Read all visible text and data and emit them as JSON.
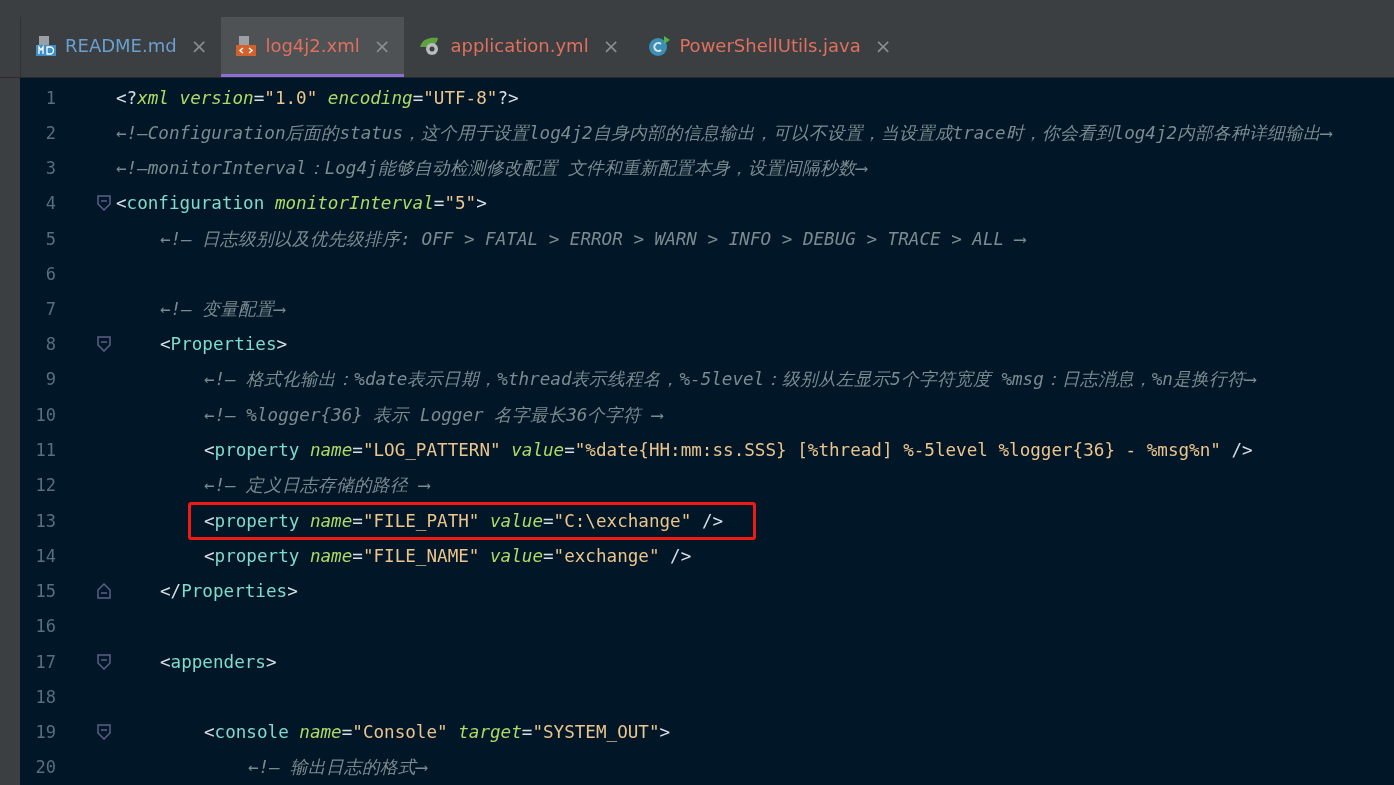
{
  "tabs": [
    {
      "label": "README.md",
      "kind": "md",
      "selected": false,
      "color": "#6a9fd0"
    },
    {
      "label": "log4j2.xml",
      "kind": "xml",
      "selected": true,
      "color": "#e0705e"
    },
    {
      "label": "application.yml",
      "kind": "yml",
      "selected": false,
      "color": "#e0705e"
    },
    {
      "label": "PowerShellUtils.java",
      "kind": "java",
      "selected": false,
      "color": "#e0705e"
    }
  ],
  "close_label": "×",
  "lines": [
    {
      "number": "1",
      "tokens": [
        {
          "kind": "punct",
          "text": "<?"
        },
        {
          "kind": "attr",
          "text": "xml"
        },
        {
          "kind": "attr",
          "text": " version"
        },
        {
          "kind": "punct",
          "text": "="
        },
        {
          "kind": "value",
          "text": "\"1.0\""
        },
        {
          "kind": "attr",
          "text": " encoding"
        },
        {
          "kind": "punct",
          "text": "="
        },
        {
          "kind": "value",
          "text": "\"UTF-8\""
        },
        {
          "kind": "punct",
          "text": "?>"
        }
      ]
    },
    {
      "number": "2",
      "tokens": [
        {
          "kind": "comment",
          "text": "←!—Configuration后面的status，这个用于设置log4j2自身内部的信息输出，可以不设置，当设置成trace时，你会看到log4j2内部各种详细输出⟶"
        }
      ]
    },
    {
      "number": "3",
      "tokens": [
        {
          "kind": "comment",
          "text": "←!—monitorInterval：Log4j能够自动检测修改配置 文件和重新配置本身，设置间隔秒数⟶"
        }
      ]
    },
    {
      "number": "4",
      "fold_start": true,
      "tokens": [
        {
          "kind": "punct",
          "text": "<"
        },
        {
          "kind": "tag",
          "text": "configuration"
        },
        {
          "kind": "attr",
          "text": " monitorInterval"
        },
        {
          "kind": "punct",
          "text": "="
        },
        {
          "kind": "value",
          "text": "\"5\""
        },
        {
          "kind": "punct",
          "text": ">"
        }
      ],
      "children": [
        {
          "number": "5",
          "tokens": [
            {
              "kind": "comment",
              "text": "←!— 日志级别以及优先级排序: OFF > FATAL > ERROR > WARN > INFO > DEBUG > TRACE > ALL ⟶"
            }
          ]
        },
        {
          "number": "6"
        },
        {
          "number": "7",
          "tokens": [
            {
              "kind": "comment",
              "text": "←!— 变量配置⟶"
            }
          ]
        },
        {
          "number": "8",
          "fold_start": true,
          "tokens": [
            {
              "kind": "punct",
              "text": "<"
            },
            {
              "kind": "tag",
              "text": "Properties"
            },
            {
              "kind": "punct",
              "text": ">"
            }
          ],
          "children": [
            {
              "number": "9",
              "tokens": [
                {
                  "kind": "comment",
                  "text": "←!— 格式化输出：%date表示日期，%thread表示线程名，%-5level：级别从左显示5个字符宽度 %msg：日志消息，%n是换行符⟶"
                }
              ]
            },
            {
              "number": "10",
              "tokens": [
                {
                  "kind": "comment",
                  "text": "←!— %logger{36} 表示 Logger 名字最长36个字符 ⟶"
                }
              ]
            },
            {
              "number": "11",
              "tokens": [
                {
                  "kind": "punct",
                  "text": "<"
                },
                {
                  "kind": "tag",
                  "text": "property"
                },
                {
                  "kind": "attr",
                  "text": " name"
                },
                {
                  "kind": "punct",
                  "text": "="
                },
                {
                  "kind": "value",
                  "text": "\"LOG_PATTERN\""
                },
                {
                  "kind": "attr",
                  "text": " value"
                },
                {
                  "kind": "punct",
                  "text": "="
                },
                {
                  "kind": "value",
                  "text": "\"%date{HH:mm:ss.SSS} [%thread] %-5level %logger{36} - %msg%n\""
                },
                {
                  "kind": "punct",
                  "text": " />"
                }
              ]
            },
            {
              "number": "12",
              "tokens": [
                {
                  "kind": "comment",
                  "text": "←!— 定义日志存储的路径 ⟶"
                }
              ]
            },
            {
              "number": "13",
              "highlighted": true,
              "tokens": [
                {
                  "kind": "punct",
                  "text": "<"
                },
                {
                  "kind": "tag",
                  "text": "property"
                },
                {
                  "kind": "attr",
                  "text": " name"
                },
                {
                  "kind": "punct",
                  "text": "="
                },
                {
                  "kind": "value",
                  "text": "\"FILE_PATH\""
                },
                {
                  "kind": "attr",
                  "text": " value"
                },
                {
                  "kind": "punct",
                  "text": "="
                },
                {
                  "kind": "value",
                  "text": "\"C:\\exchange\""
                },
                {
                  "kind": "punct",
                  "text": " />"
                }
              ]
            },
            {
              "number": "14",
              "tokens": [
                {
                  "kind": "punct",
                  "text": "<"
                },
                {
                  "kind": "tag",
                  "text": "property"
                },
                {
                  "kind": "attr",
                  "text": " name"
                },
                {
                  "kind": "punct",
                  "text": "="
                },
                {
                  "kind": "value",
                  "text": "\"FILE_NAME\""
                },
                {
                  "kind": "attr",
                  "text": " value"
                },
                {
                  "kind": "punct",
                  "text": "="
                },
                {
                  "kind": "value",
                  "text": "\"exchange\""
                },
                {
                  "kind": "punct",
                  "text": " />"
                }
              ]
            }
          ]
        },
        {
          "number": "15",
          "fold_end": true,
          "tokens": [
            {
              "kind": "punct",
              "text": "</"
            },
            {
              "kind": "tag",
              "text": "Properties"
            },
            {
              "kind": "punct",
              "text": ">"
            }
          ]
        },
        {
          "number": "16"
        },
        {
          "number": "17",
          "fold_start": true,
          "tokens": [
            {
              "kind": "punct",
              "text": "<"
            },
            {
              "kind": "tag",
              "text": "appenders"
            },
            {
              "kind": "punct",
              "text": ">"
            }
          ],
          "children": [
            {
              "number": "18"
            },
            {
              "number": "19",
              "fold_start": true,
              "tokens": [
                {
                  "kind": "punct",
                  "text": "<"
                },
                {
                  "kind": "tag",
                  "text": "console"
                },
                {
                  "kind": "attr",
                  "text": " name"
                },
                {
                  "kind": "punct",
                  "text": "="
                },
                {
                  "kind": "value",
                  "text": "\"Console\""
                },
                {
                  "kind": "attr",
                  "text": " target"
                },
                {
                  "kind": "punct",
                  "text": "="
                },
                {
                  "kind": "value",
                  "text": "\"SYSTEM_OUT\""
                },
                {
                  "kind": "punct",
                  "text": ">"
                }
              ],
              "children": [
                {
                  "number": "20",
                  "tokens": [
                    {
                      "kind": "comment",
                      "text": "←!— 输出日志的格式⟶"
                    }
                  ]
                }
              ]
            }
          ]
        }
      ]
    }
  ]
}
